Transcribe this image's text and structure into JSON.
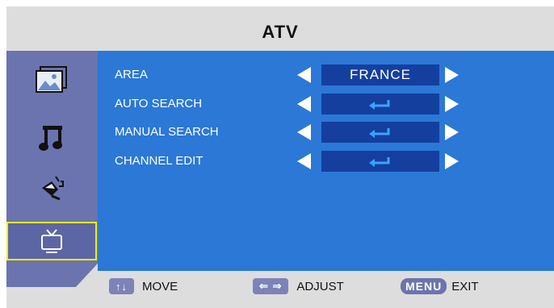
{
  "header": {
    "title": "ATV"
  },
  "sidebar": {
    "items": [
      {
        "icon": "picture-icon",
        "active": false
      },
      {
        "icon": "music-note-icon",
        "active": false
      },
      {
        "icon": "setup-tools-icon",
        "active": false
      },
      {
        "icon": "tv-icon",
        "active": true
      }
    ]
  },
  "menu": {
    "rows": [
      {
        "label": "AREA",
        "value": "FRANCE"
      },
      {
        "label": "AUTO SEARCH",
        "value_icon": "enter-icon"
      },
      {
        "label": "MANUAL SEARCH",
        "value_icon": "enter-icon"
      },
      {
        "label": "CHANNEL EDIT",
        "value_icon": "enter-icon"
      }
    ]
  },
  "footer": {
    "move": {
      "key": "↑↓",
      "label": "MOVE"
    },
    "adjust": {
      "key": "⇐ ⇒",
      "label": "ADJUST"
    },
    "exit": {
      "key": "MENU",
      "label": "EXIT"
    }
  },
  "colors": {
    "main_bg": "#2b78d6",
    "value_box": "#143f9e",
    "sidebar_bg": "#6b74ae",
    "active_border": "#f0f000",
    "frame_bg": "#dddddd"
  }
}
